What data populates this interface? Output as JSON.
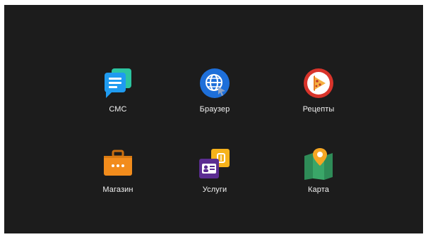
{
  "apps": [
    {
      "label": "СМС",
      "icon": "sms-chat-icon"
    },
    {
      "label": "Браузер",
      "icon": "globe-browser-icon"
    },
    {
      "label": "Рецепты",
      "icon": "pizza-slice-icon"
    },
    {
      "label": "Магазин",
      "icon": "briefcase-icon"
    },
    {
      "label": "Услуги",
      "icon": "contact-cards-icon"
    },
    {
      "label": "Карта",
      "icon": "map-pin-icon"
    }
  ],
  "colors": {
    "background": "#1c1c1c",
    "label_text": "#f2f2f2",
    "sms_primary": "#1f9bf0",
    "sms_secondary": "#2bc4a0",
    "browser_blue": "#1e6fd9",
    "recipes_red": "#d9342b",
    "shop_orange": "#f28c1c",
    "services_purple": "#5b2d91",
    "services_yellow": "#f6b21b",
    "map_green": "#2e8b57",
    "map_pin": "#f5a623"
  }
}
